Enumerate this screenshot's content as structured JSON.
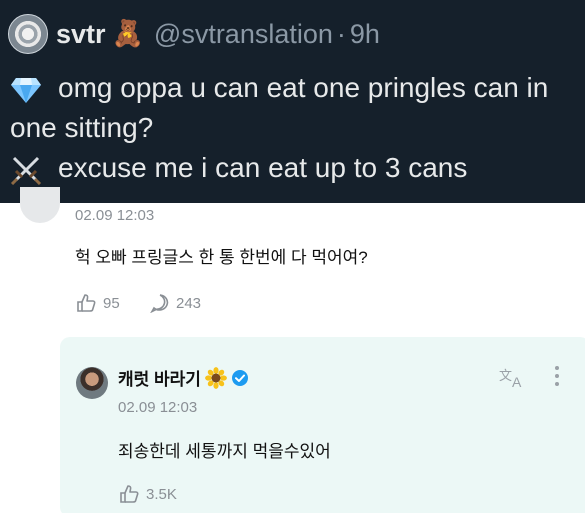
{
  "tweet": {
    "display_name": "svtr",
    "name_emoji": "🧸",
    "handle": "@svtranslation",
    "separator": "·",
    "time": "9h",
    "lines": [
      {
        "icon": "diamond-icon",
        "text": "omg oppa u can eat one pringles can in one sitting?"
      },
      {
        "icon": "crossed-swords-icon",
        "text": "excuse me i can eat up to 3 cans"
      }
    ]
  },
  "comment": {
    "time": "02.09 12:03",
    "text": "헉 오빠 프링글스 한 통 한번에 다 먹어여?",
    "likes": "95",
    "replies": "243"
  },
  "reply": {
    "name": "캐럿 바라기",
    "time": "02.09 12:03",
    "text": "죄송한데 세통까지 먹을수있어",
    "likes": "3.5K",
    "translate_icon": "translate-icon",
    "accent": "#1d9bf0",
    "card_color": "#ecf8f6"
  }
}
